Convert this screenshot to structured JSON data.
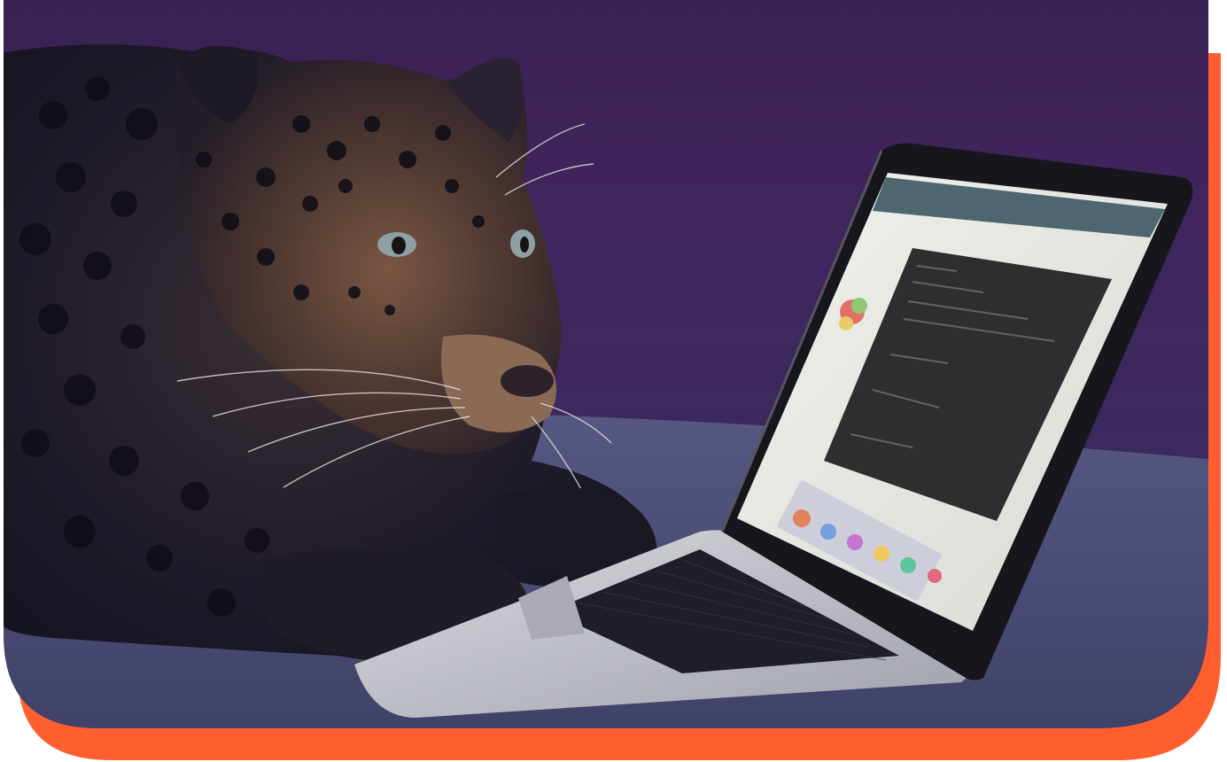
{
  "image": {
    "subject": "leopard-at-laptop",
    "colors": {
      "accent_border": "#FF5F2E",
      "wall": "#3C2257",
      "couch": "#4E5078",
      "laptop_body": "#C8C9CF",
      "screen_bg": "#EDEDE6",
      "screen_panel": "#2E2E30"
    }
  }
}
